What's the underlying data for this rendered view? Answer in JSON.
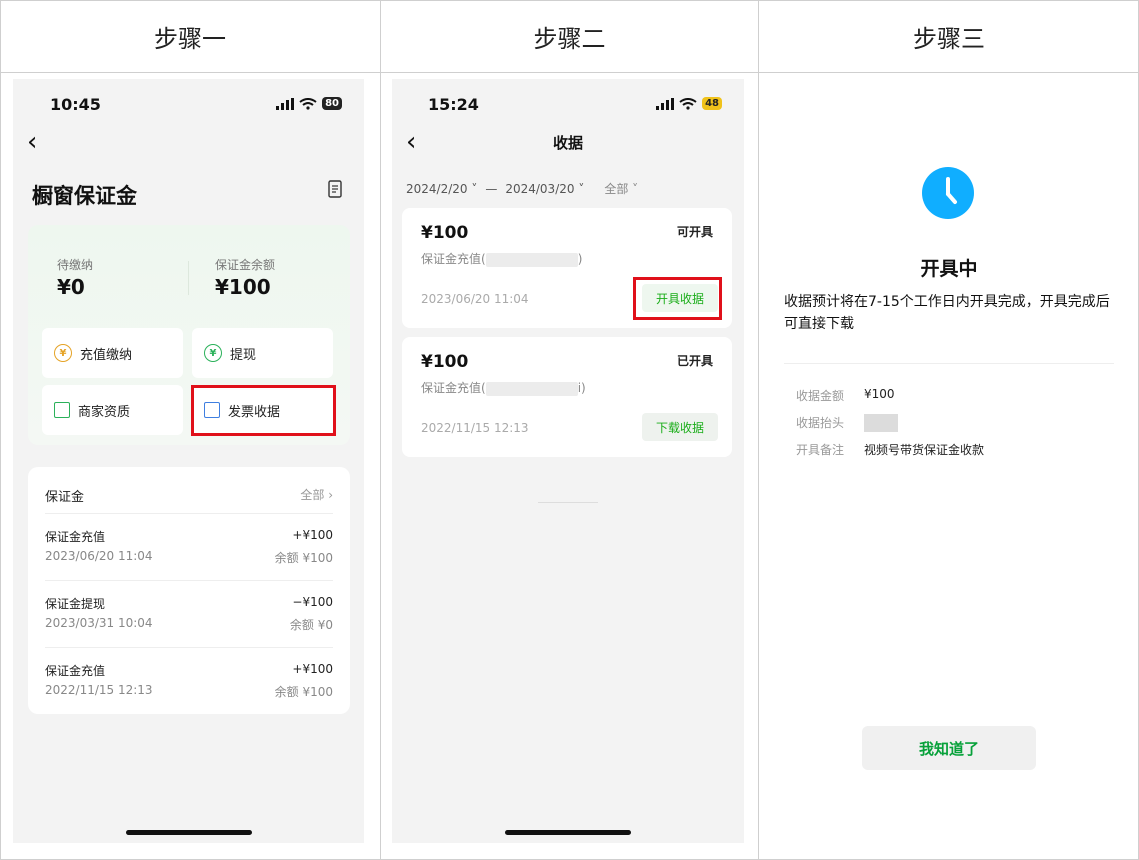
{
  "steps": [
    "步骤一",
    "步骤二",
    "步骤三"
  ],
  "phone1": {
    "time": "10:45",
    "battery": "80",
    "back": "‹",
    "title": "橱窗保证金",
    "pending_label": "待缴纳",
    "pending_value": "¥0",
    "balance_label": "保证金余额",
    "balance_value": "¥100",
    "tiles": [
      "充值缴纳",
      "提现",
      "商家资质",
      "发票收据"
    ],
    "list_title": "保证金",
    "list_all": "全部 ›",
    "rows": [
      {
        "name": "保证金充值",
        "date": "2023/06/20 11:04",
        "amount": "+¥100",
        "balance": "余额 ¥100"
      },
      {
        "name": "保证金提现",
        "date": "2023/03/31 10:04",
        "amount": "−¥100",
        "balance": "余额 ¥0"
      },
      {
        "name": "保证金充值",
        "date": "2022/11/15 12:13",
        "amount": "+¥100",
        "balance": "余额 ¥100"
      }
    ]
  },
  "phone2": {
    "time": "15:24",
    "battery": "48",
    "back": "‹",
    "title": "收据",
    "date_from": "2024/2/20 ˅",
    "date_sep": "—",
    "date_to": "2024/03/20 ˅",
    "filter_all": "全部 ˅",
    "receipts": [
      {
        "amount": "¥100",
        "status": "可开具",
        "desc_prefix": "保证金充值(",
        "desc_suffix": ")",
        "date": "2023/06/20 11:04",
        "button": "开具收据"
      },
      {
        "amount": "¥100",
        "status": "已开具",
        "desc_prefix": "保证金充值(",
        "desc_suffix": "i)",
        "date": "2022/11/15 12:13",
        "button": "下载收据"
      }
    ]
  },
  "panel3": {
    "title": "开具中",
    "desc": "收据预计将在7-15个工作日内开具完成，开具完成后可直接下载",
    "fields": [
      {
        "key": "收据金额",
        "value": "¥100"
      },
      {
        "key": "收据抬头",
        "value": ""
      },
      {
        "key": "开具备注",
        "value": "视频号带货保证金收款"
      }
    ],
    "ok_button": "我知道了"
  }
}
